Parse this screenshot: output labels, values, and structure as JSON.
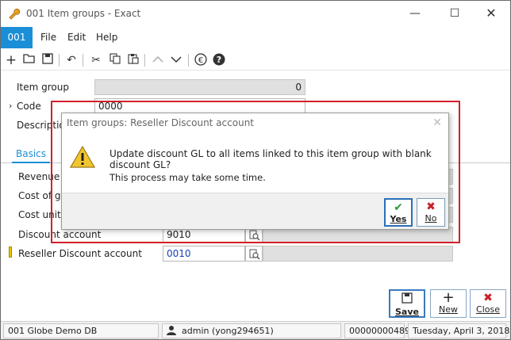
{
  "window": {
    "title": "001 Item groups - Exact",
    "min_glyph": "—",
    "max_glyph": "☐",
    "close_glyph": "✕"
  },
  "menubar": {
    "tag": "001",
    "items": [
      {
        "label": "File"
      },
      {
        "label": "Edit"
      },
      {
        "label": "Help"
      }
    ]
  },
  "toolbar": {
    "icons": [
      "add-icon",
      "open-folder-icon",
      "save-disk-icon",
      "undo-icon",
      "cut-icon",
      "copy-icon",
      "paste-icon",
      "arrow-up-icon",
      "arrow-down-icon",
      "euro-icon",
      "help-icon"
    ]
  },
  "form": {
    "item_group_label": "Item group",
    "item_group_value": "0",
    "code_label": "Code",
    "code_value": "0000",
    "description_label": "Descriptio",
    "tab_basics": "Basics",
    "revenue_label": "Revenue a",
    "cost_goods_label": "Cost of go",
    "cost_unit_label": "Cost unit",
    "discount_account_label": "Discount account",
    "discount_account_value": "9010",
    "reseller_discount_label": "Reseller Discount account",
    "reseller_discount_value": "0010"
  },
  "dialog": {
    "title": "Item groups: Reseller Discount account",
    "close_glyph": "✕",
    "message": "Update discount GL to all items linked to this item group with blank discount GL?",
    "submessage": "This process may take some time.",
    "yes_label": "Yes",
    "no_label": "No",
    "highlight_color": "#d0202a"
  },
  "actions": {
    "save_label": "Save",
    "new_label": "New",
    "close_label": "Close"
  },
  "status": {
    "database": "001 Globe Demo DB",
    "user": "admin (yong294651)",
    "number": "00000000489",
    "date": "Tuesday, April 3, 2018"
  },
  "colors": {
    "accent": "#1a8fd8",
    "yes_green": "#2a9a3a",
    "no_red": "#c8202a"
  }
}
